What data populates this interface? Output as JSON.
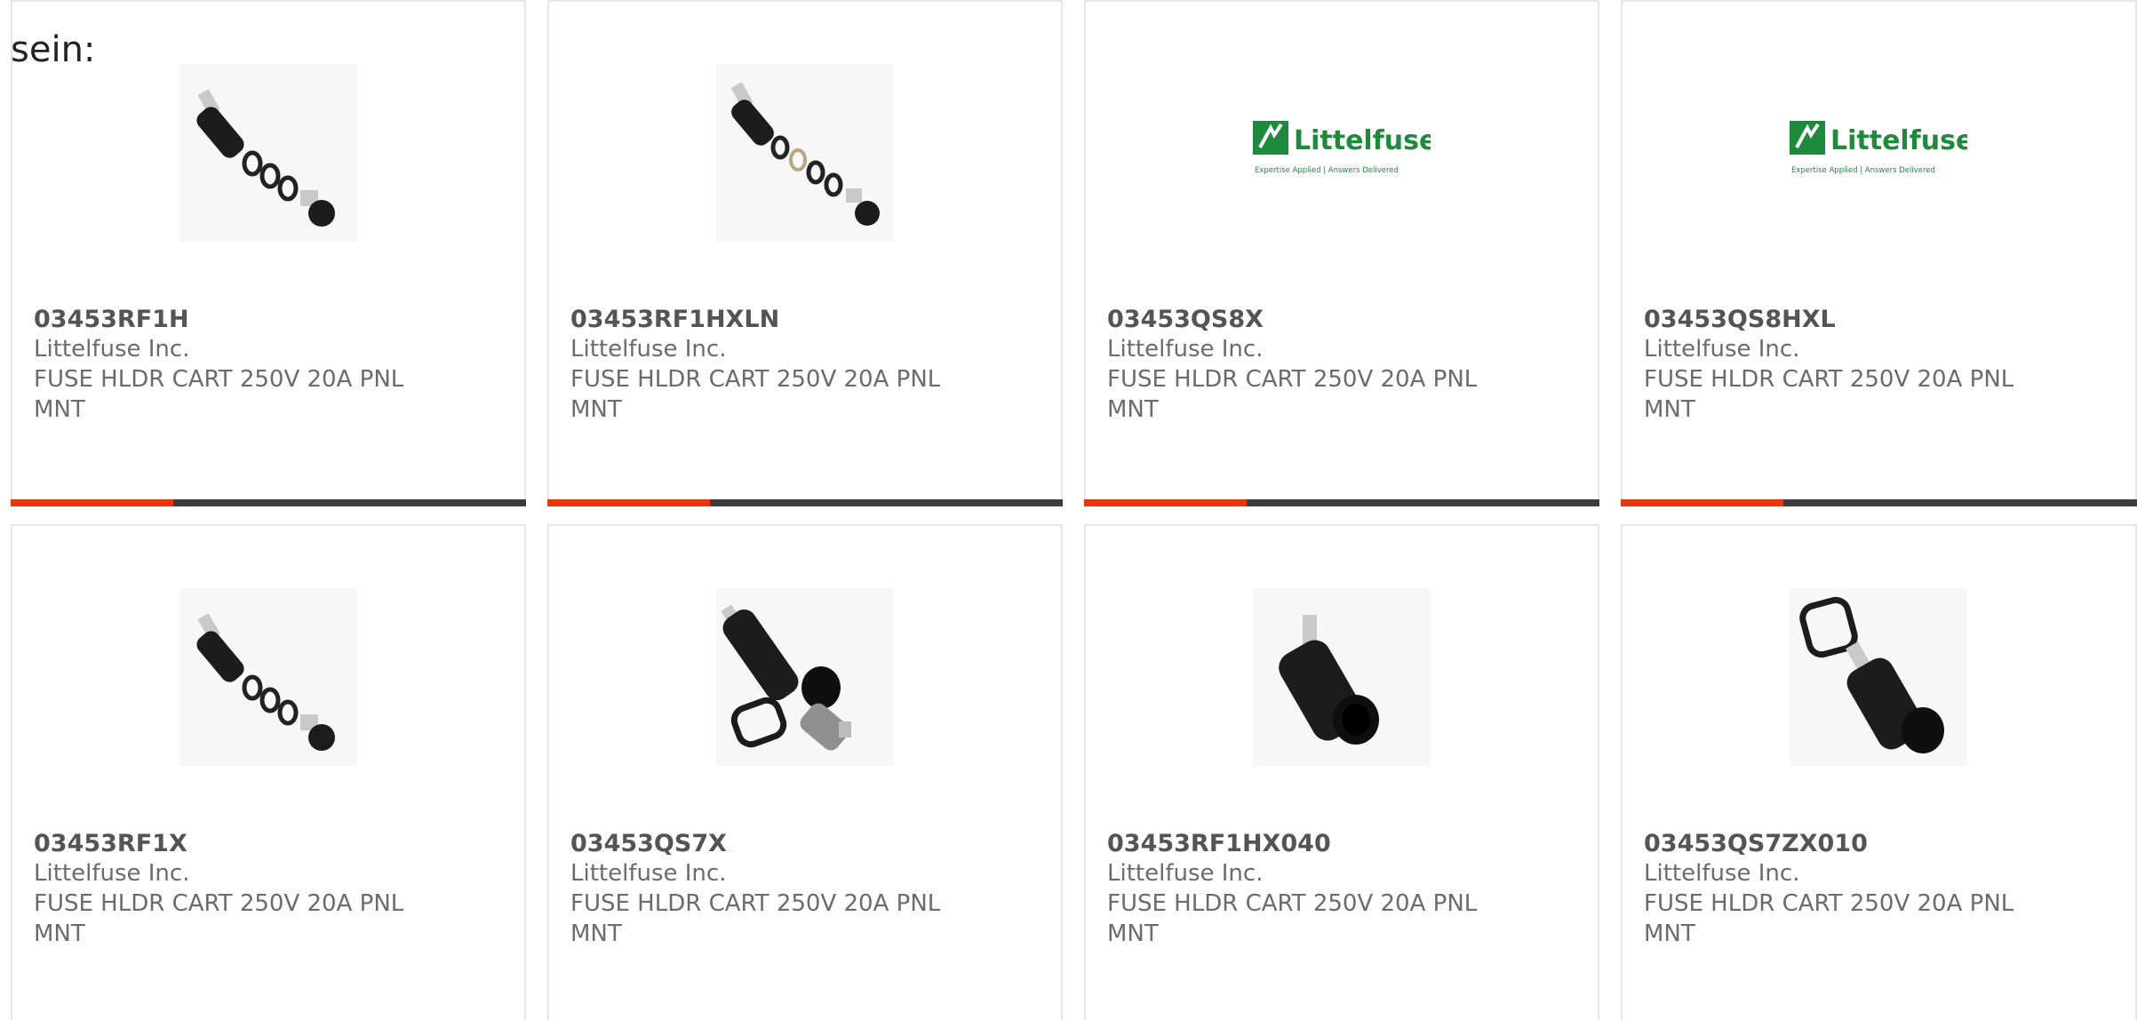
{
  "intro_text": "sein:",
  "brand_colors": {
    "accent": "#e8360e",
    "bar": "#3d3d3d",
    "littelfuse_green": "#1e8a3c"
  },
  "logo": {
    "name": "Littelfuse",
    "tagline": "Expertise Applied | Answers Delivered"
  },
  "products": [
    {
      "part_number": "03453RF1H",
      "manufacturer": "Littelfuse Inc.",
      "description": "FUSE HLDR CART 250V 20A PNL MNT",
      "image": "fuse-holder-exploded-icon"
    },
    {
      "part_number": "03453RF1HXLN",
      "manufacturer": "Littelfuse Inc.",
      "description": "FUSE HLDR CART 250V 20A PNL MNT",
      "image": "fuse-holder-exploded-icon"
    },
    {
      "part_number": "03453QS8X",
      "manufacturer": "Littelfuse Inc.",
      "description": "FUSE HLDR CART 250V 20A PNL MNT",
      "image": "littelfuse-logo"
    },
    {
      "part_number": "03453QS8HXL",
      "manufacturer": "Littelfuse Inc.",
      "description": "FUSE HLDR CART 250V 20A PNL MNT",
      "image": "littelfuse-logo"
    },
    {
      "part_number": "03453RF1X",
      "manufacturer": "Littelfuse Inc.",
      "description": "FUSE HLDR CART 250V 20A PNL MNT",
      "image": "fuse-holder-exploded-icon"
    },
    {
      "part_number": "03453QS7X",
      "manufacturer": "Littelfuse Inc.",
      "description": "FUSE HLDR CART 250V 20A PNL MNT",
      "image": "fuse-holder-with-cap-icon"
    },
    {
      "part_number": "03453RF1HX040",
      "manufacturer": "Littelfuse Inc.",
      "description": "FUSE HLDR CART 250V 20A PNL MNT",
      "image": "fuse-holder-body-icon"
    },
    {
      "part_number": "03453QS7ZX010",
      "manufacturer": "Littelfuse Inc.",
      "description": "FUSE HLDR CART 250V 20A PNL MNT",
      "image": "fuse-holder-with-gasket-icon"
    }
  ]
}
